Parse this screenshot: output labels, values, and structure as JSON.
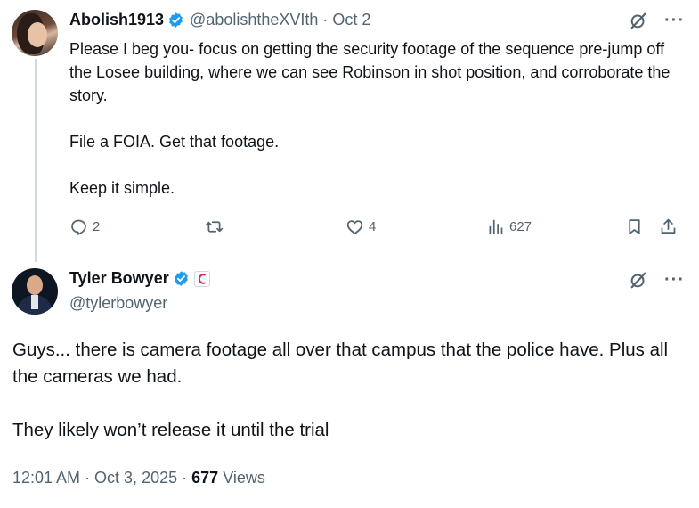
{
  "parent_tweet": {
    "display_name": "Abolish1913",
    "handle": "@abolishtheXVIth",
    "separator": "·",
    "date": "Oct 2",
    "paragraphs": [
      "Please I beg you- focus on getting the security footage of the sequence pre-jump off the Losee building, where we can see Robinson in shot position, and corroborate the story.",
      "File a FOIA. Get that footage.",
      "Keep it simple."
    ],
    "actions": {
      "replies": "2",
      "retweets": "",
      "likes": "4",
      "views": "627"
    },
    "icons": [
      "verified-badge-icon",
      "grok-icon",
      "more-icon",
      "reply-icon",
      "retweet-icon",
      "like-icon",
      "views-icon",
      "bookmark-icon",
      "share-icon"
    ]
  },
  "main_tweet": {
    "display_name": "Tyler Bowyer",
    "handle": "@tylerbowyer",
    "paragraphs": [
      "Guys... there is camera footage all over that campus that the police have. Plus all the cameras we had.",
      "They likely won’t release it until the trial"
    ],
    "timestamp": "12:01 AM · Oct 3, 2025 ·",
    "views_count": "677",
    "views_label": "Views",
    "icons": [
      "verified-badge-icon",
      "affiliation-badge-icon",
      "grok-icon",
      "more-icon"
    ]
  },
  "colors": {
    "verified_blue": "#1d9bf0",
    "secondary_text": "#536471",
    "primary_text": "#0f1419",
    "affiliation_red": "#e0245e"
  }
}
